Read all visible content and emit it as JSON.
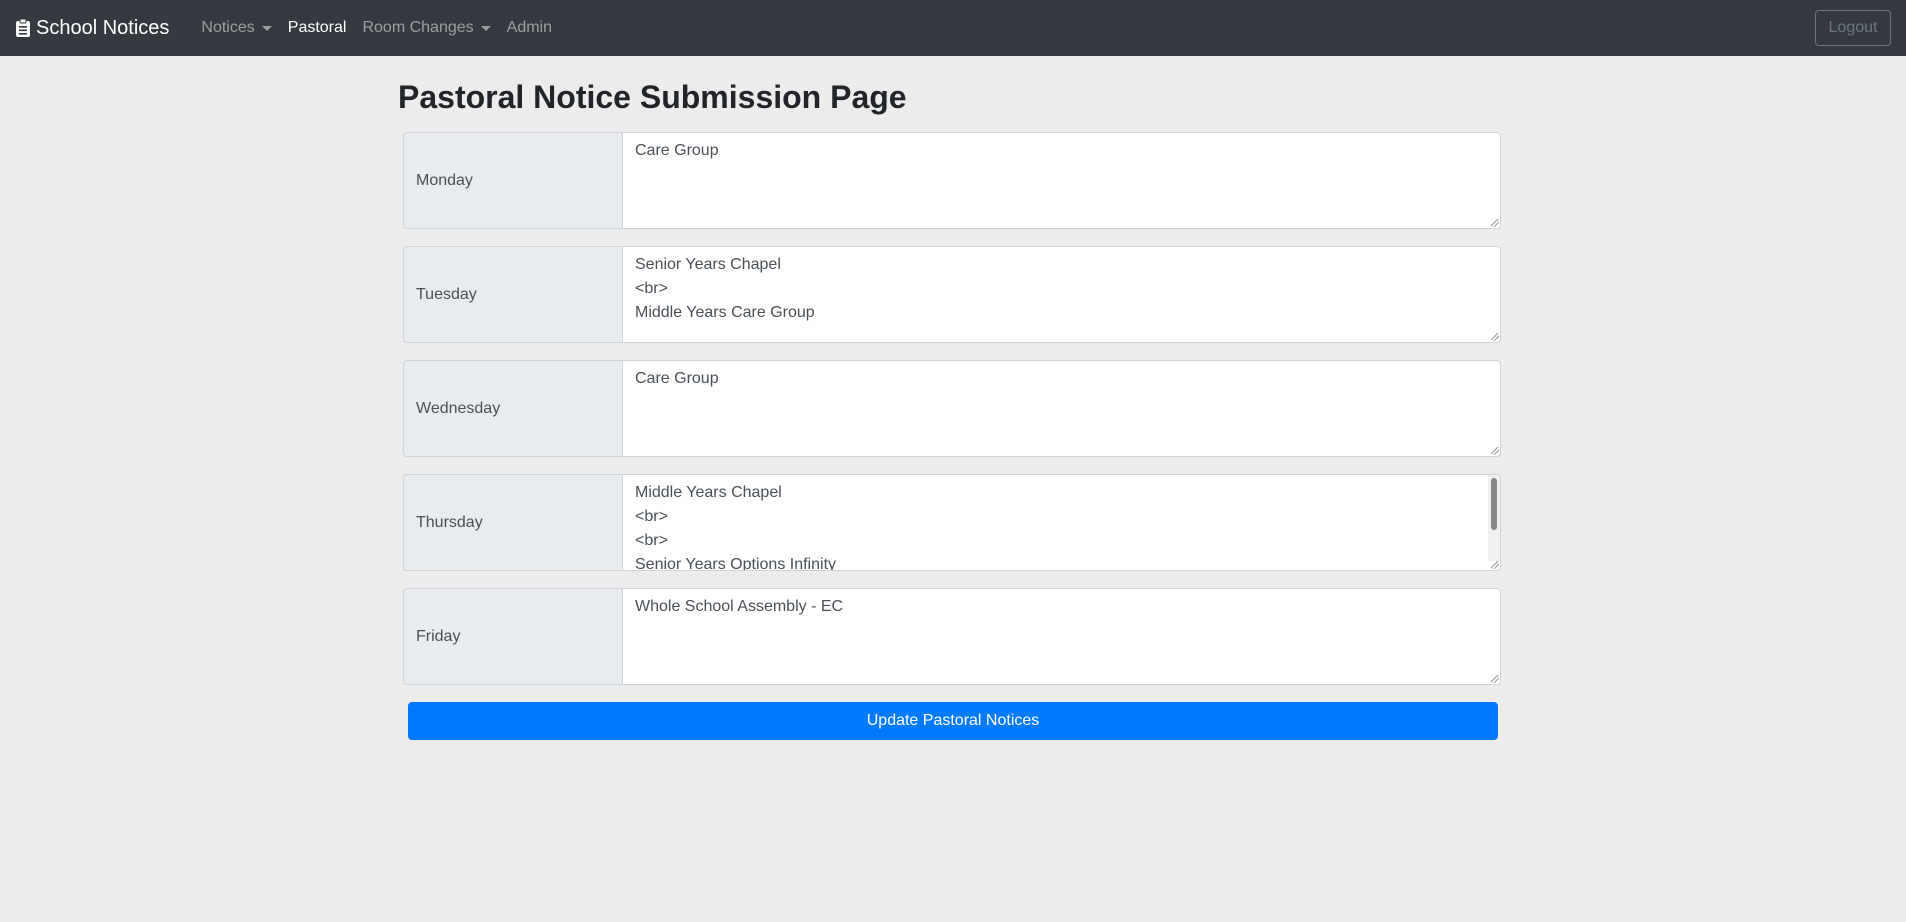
{
  "navbar": {
    "brand": "School Notices",
    "items": [
      {
        "label": "Notices",
        "dropdown": true,
        "active": false
      },
      {
        "label": "Pastoral",
        "dropdown": false,
        "active": true
      },
      {
        "label": "Room Changes",
        "dropdown": true,
        "active": false
      },
      {
        "label": "Admin",
        "dropdown": false,
        "active": false
      }
    ],
    "logout": "Logout"
  },
  "page": {
    "title": "Pastoral Notice Submission Page",
    "submit_label": "Update Pastoral Notices"
  },
  "days": [
    {
      "label": "Monday",
      "value": "Care Group"
    },
    {
      "label": "Tuesday",
      "value": "Senior Years Chapel\n<br>\nMiddle Years Care Group"
    },
    {
      "label": "Wednesday",
      "value": "Care Group"
    },
    {
      "label": "Thursday",
      "value": "Middle Years Chapel\n<br>\n<br>\nSenior Years Options Infinity"
    },
    {
      "label": "Friday",
      "value": "Whole School Assembly - EC"
    }
  ],
  "colors": {
    "navbar_bg": "#343a40",
    "page_bg": "#ececec",
    "primary": "#007bff"
  }
}
